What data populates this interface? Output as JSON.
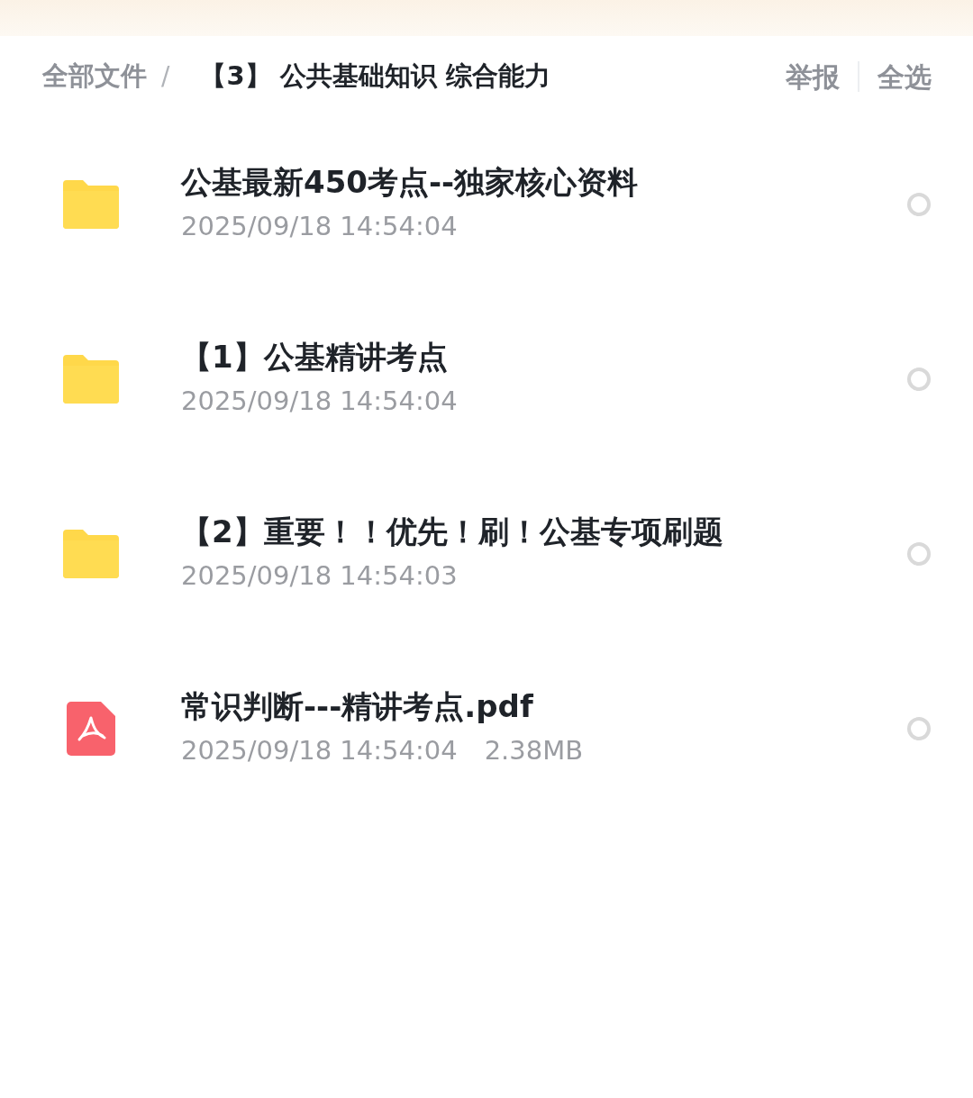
{
  "breadcrumb": {
    "root": "全部文件",
    "separator": "/",
    "current": "【3】 公共基础知识 综合能力"
  },
  "actions": [
    "举报",
    "全选"
  ],
  "files": [
    {
      "kind": "folder",
      "name": "公基最新450考点--独家核心资料",
      "time": "2025/09/18 14:54:04",
      "selected": false
    },
    {
      "kind": "folder",
      "name": "【1】公基精讲考点",
      "time": "2025/09/18 14:54:04",
      "selected": false
    },
    {
      "kind": "folder",
      "name": "【2】重要！！优先！刷！公基专项刷题",
      "time": "2025/09/18 14:54:03",
      "selected": false
    },
    {
      "kind": "pdf",
      "name": "常识判断---精讲考点.pdf",
      "time": "2025/09/18 14:54:04",
      "size": "2.38MB",
      "selected": false
    }
  ]
}
